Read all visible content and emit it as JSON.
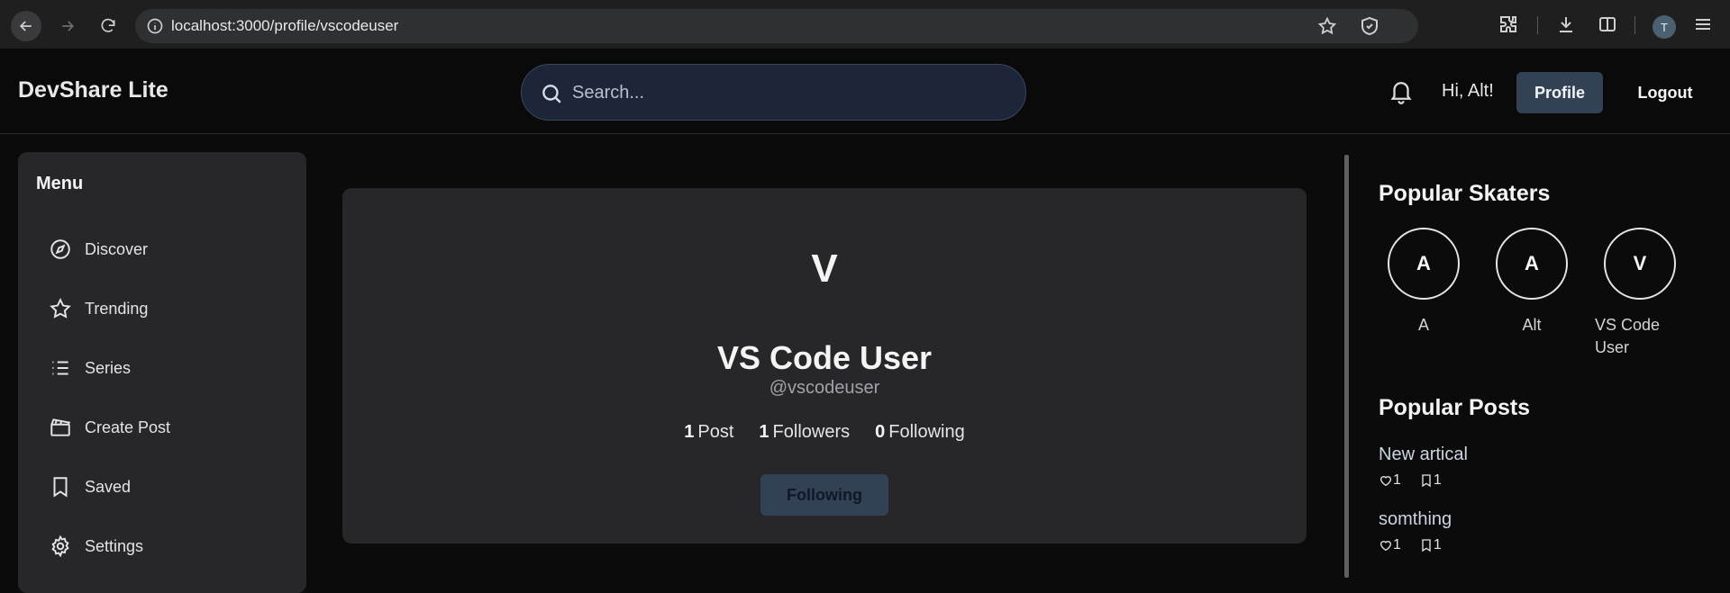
{
  "browser": {
    "url": "localhost:3000/profile/vscodeuser",
    "profile_initial": "T"
  },
  "header": {
    "brand": "DevShare Lite",
    "search_placeholder": "Search...",
    "greeting": "Hi, Alt!",
    "profile_label": "Profile",
    "logout_label": "Logout"
  },
  "sidebar": {
    "title": "Menu",
    "items": [
      {
        "label": "Discover",
        "icon": "compass-icon"
      },
      {
        "label": "Trending",
        "icon": "star-icon"
      },
      {
        "label": "Series",
        "icon": "list-icon"
      },
      {
        "label": "Create Post",
        "icon": "clapperboard-icon"
      },
      {
        "label": "Saved",
        "icon": "bookmark-icon"
      },
      {
        "label": "Settings",
        "icon": "gear-icon"
      }
    ]
  },
  "profile": {
    "initial": "V",
    "name": "VS Code User",
    "handle": "@vscodeuser",
    "posts_count": "1",
    "posts_label": "Post",
    "followers_count": "1",
    "followers_label": "Followers",
    "following_count": "0",
    "following_label": "Following",
    "follow_button": "Following"
  },
  "right_panel": {
    "skaters_title": "Popular Skaters",
    "skaters": [
      {
        "initial": "A",
        "name": "A"
      },
      {
        "initial": "A",
        "name": "Alt"
      },
      {
        "initial": "V",
        "name": "VS Code User"
      }
    ],
    "posts_title": "Popular Posts",
    "posts": [
      {
        "title": "New artical",
        "likes": "1",
        "saves": "1"
      },
      {
        "title": "somthing",
        "likes": "1",
        "saves": "1"
      }
    ]
  },
  "colors": {
    "accent_button": "#334155",
    "card": "#27272a",
    "search_bg": "#1c2638"
  }
}
